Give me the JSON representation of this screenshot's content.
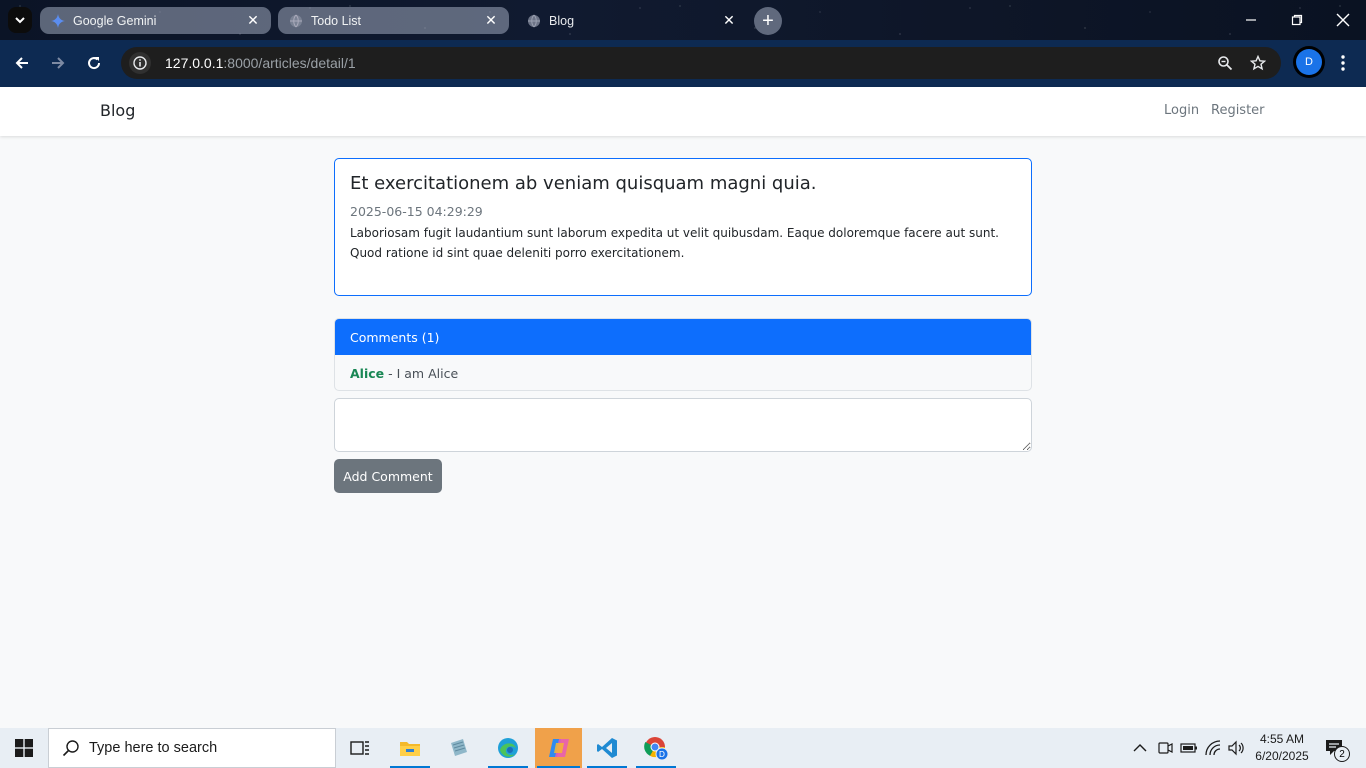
{
  "browser": {
    "tabs": [
      {
        "title": "Google Gemini",
        "icon": "gemini-icon",
        "active": false
      },
      {
        "title": "Todo List",
        "icon": "globe-icon",
        "active": false
      },
      {
        "title": "Blog",
        "icon": "globe-icon",
        "active": true
      }
    ],
    "url": {
      "host": "127.0.0.1",
      "path": ":8000/articles/detail/1"
    },
    "profile_initial": "D"
  },
  "navbar": {
    "brand": "Blog",
    "links": [
      "Login",
      "Register"
    ]
  },
  "article": {
    "title": "Et exercitationem ab veniam quisquam magni quia.",
    "date": "2025-06-15 04:29:29",
    "body": "Laboriosam fugit laudantium sunt laborum expedita ut velit quibusdam. Eaque doloremque facere aut sunt. Quod ratione id sint quae deleniti porro exercitationem."
  },
  "comments": {
    "header": "Comments (1)",
    "items": [
      {
        "author": "Alice",
        "separator": " - ",
        "text": "I am Alice"
      }
    ]
  },
  "comment_form": {
    "textarea_value": "",
    "submit_label": "Add Comment"
  },
  "taskbar": {
    "search_placeholder": "Type here to search",
    "apps": [
      "task-view-icon",
      "file-explorer-icon",
      "notepad-icon",
      "edge-icon",
      "copilot-icon",
      "vscode-icon",
      "chrome-icon"
    ],
    "clock_time": "4:55 AM",
    "clock_date": "6/20/2025",
    "notification_count": "2"
  },
  "colors": {
    "primary": "#0d6efd",
    "secondary": "#6c757d",
    "success": "#198754",
    "toolbar": "#0d2a52"
  }
}
